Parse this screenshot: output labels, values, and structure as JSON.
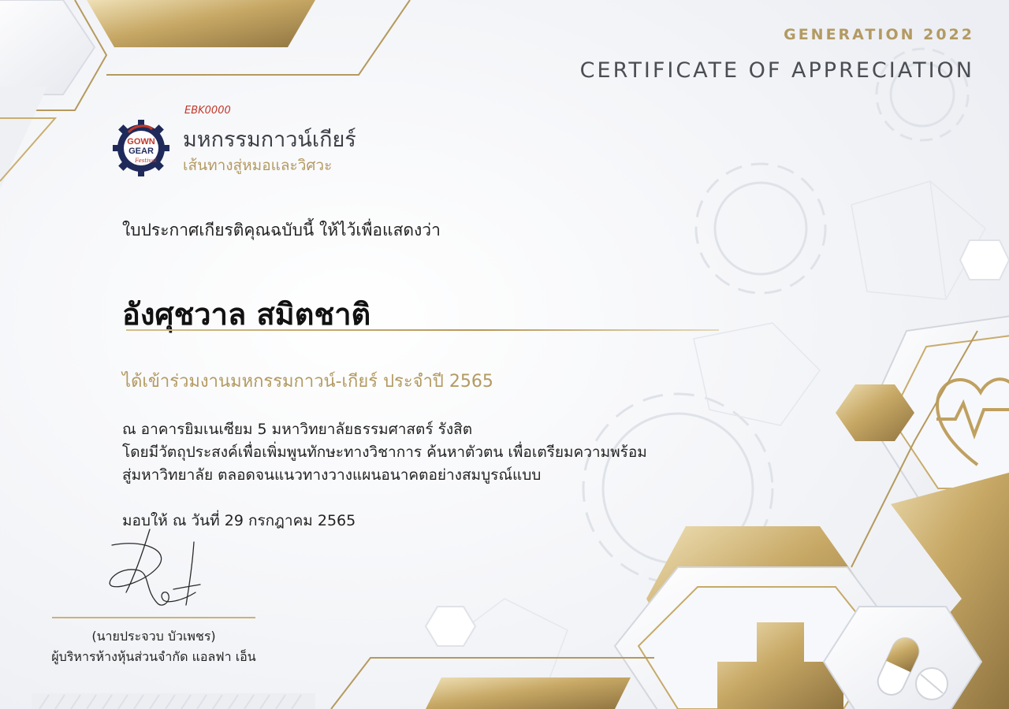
{
  "header": {
    "generation": "GENERATION 2022",
    "certificate_title": "CERTIFICATE OF APPRECIATION"
  },
  "organizer": {
    "code": "EBK0000",
    "name": "มหกรรมกาวน์เกียร์",
    "tagline": "เส้นทางสู่หมอและวิศวะ",
    "logo_text": [
      "GOWN",
      "GEAR",
      "Festival"
    ]
  },
  "certificate": {
    "intro": "ใบประกาศเกียรติคุณฉบับนี้ ให้ไว้เพื่อแสดงว่า",
    "recipient_name": "อังศุชวาล สมิตชาติ",
    "attended": "ได้เข้าร่วมงานมหกรรมกาวน์-เกียร์ ประจำปี 2565",
    "body_lines": [
      "ณ อาคารยิมเนเซียม 5 มหาวิทยาลัยธรรมศาสตร์ รังสิต",
      "โดยมีวัตถุประสงค์เพื่อเพิ่มพูนทักษะทางวิชาการ ค้นหาตัวตน เพื่อเตรียมความพร้อม",
      "สู่มหาวิทยาลัย ตลอดจนแนวทางวางแผนอนาคตอย่างสมบูรณ์แบบ"
    ],
    "date": "มอบให้ ณ วันที่ 29 กรกฎาคม 2565"
  },
  "signatory": {
    "name": "(นายประจวบ บัวเพชร)",
    "position": "ผู้บริหารห้างหุ้นส่วนจำกัด แอลฟา เอ็น"
  },
  "colors": {
    "gold": "#b39a62",
    "gold_light": "#e6d3a3",
    "text_dark": "#1c1c1c",
    "title_gray": "#4a4d53",
    "code_red": "#c0392b",
    "logo_navy": "#1f2a5a"
  },
  "icons": [
    "heart-pulse-icon",
    "medical-cross-icon",
    "capsule-icon",
    "pill-icon",
    "gear-icon"
  ]
}
